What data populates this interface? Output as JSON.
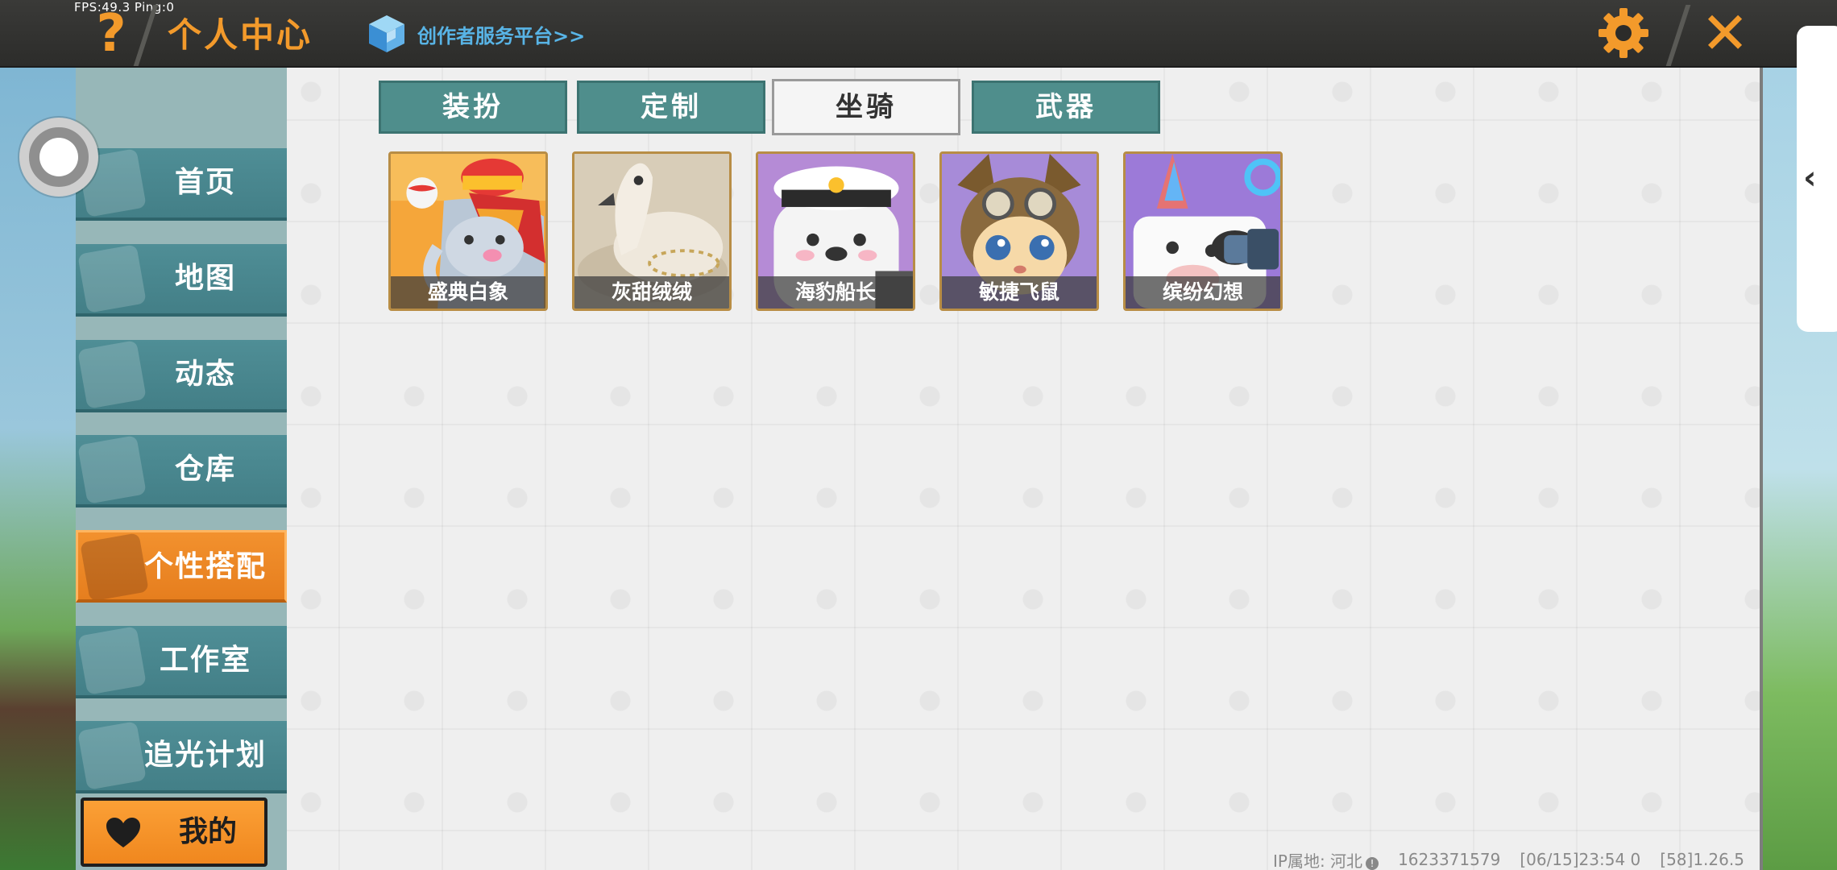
{
  "status": {
    "fps": "FPS:49.3  Ping:0"
  },
  "header": {
    "help_symbol": "?",
    "title": "个人中心",
    "creator_link": "创作者服务平台>>",
    "close_symbol": "✕"
  },
  "sidebar": {
    "items": [
      {
        "label": "首页",
        "icon": "house-icon"
      },
      {
        "label": "地图",
        "icon": "picture-icon"
      },
      {
        "label": "动态",
        "icon": "bell-icon"
      },
      {
        "label": "仓库",
        "icon": "warehouse-icon"
      },
      {
        "label": "个性搭配",
        "icon": "character-icon",
        "active": true
      },
      {
        "label": "工作室",
        "icon": "tree-icon"
      },
      {
        "label": "追光计划",
        "icon": "light-plan-icon"
      }
    ],
    "mine_label": "我的"
  },
  "tabs": [
    {
      "label": "装扮"
    },
    {
      "label": "定制"
    },
    {
      "label": "坐骑",
      "selected": true
    },
    {
      "label": "武器"
    }
  ],
  "mounts": [
    {
      "name": "盛典白象",
      "icon": "elephant-mount-icon"
    },
    {
      "name": "灰甜绒绒",
      "icon": "swan-mount-icon"
    },
    {
      "name": "海豹船长",
      "icon": "seal-captain-mount-icon"
    },
    {
      "name": "敏捷飞鼠",
      "icon": "flying-squirrel-mount-icon"
    },
    {
      "name": "缤纷幻想",
      "icon": "unicorn-cow-mount-icon"
    }
  ],
  "footer": {
    "ip_location": "IP属地: 河北",
    "uid": "1623371579",
    "timestamp": "[06/15]23:54 0",
    "version": "[58]1.26.5"
  },
  "colors": {
    "accent_orange": "#f39a2b",
    "teal": "#4f8e96",
    "topbar": "#2c2c2a"
  }
}
